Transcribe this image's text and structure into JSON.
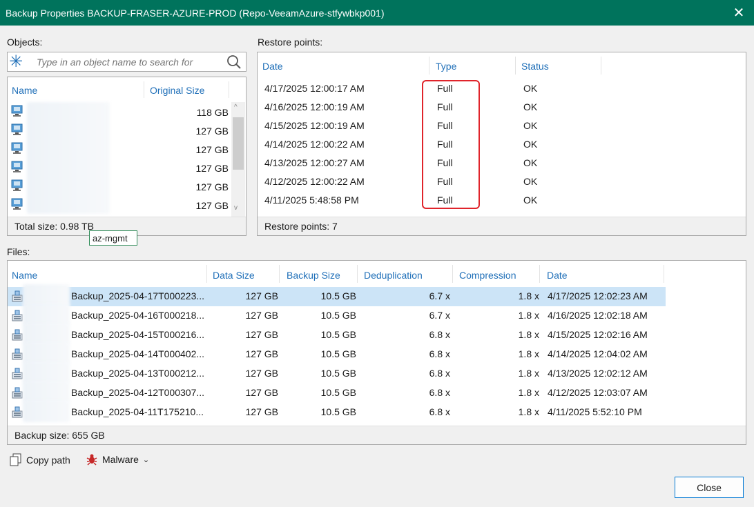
{
  "window": {
    "title": "Backup Properties BACKUP-FRASER-AZURE-PROD (Repo-VeeamAzure-stfywbkp001)",
    "close_icon": "close-icon"
  },
  "objects": {
    "label": "Objects:",
    "search": {
      "placeholder": "Type in an object name to search for",
      "value": ""
    },
    "columns": {
      "name": "Name",
      "size": "Original Size"
    },
    "rows": [
      {
        "name": "",
        "size": "118 GB"
      },
      {
        "name": "",
        "size": "127 GB"
      },
      {
        "name": "",
        "size": "127 GB"
      },
      {
        "name": "",
        "size": "127 GB"
      },
      {
        "name": "",
        "size": "127 GB"
      },
      {
        "name": "",
        "size": "127 GB"
      }
    ],
    "total": "Total size: 0.98 TB",
    "tooltip": "az-mgmt"
  },
  "restore_points": {
    "label": "Restore points:",
    "columns": {
      "date": "Date",
      "type": "Type",
      "status": "Status"
    },
    "rows": [
      {
        "date": "4/17/2025 12:00:17 AM",
        "type": "Full",
        "status": "OK"
      },
      {
        "date": "4/16/2025 12:00:19 AM",
        "type": "Full",
        "status": "OK"
      },
      {
        "date": "4/15/2025 12:00:19 AM",
        "type": "Full",
        "status": "OK"
      },
      {
        "date": "4/14/2025 12:00:22 AM",
        "type": "Full",
        "status": "OK"
      },
      {
        "date": "4/13/2025 12:00:27 AM",
        "type": "Full",
        "status": "OK"
      },
      {
        "date": "4/12/2025 12:00:22 AM",
        "type": "Full",
        "status": "OK"
      },
      {
        "date": "4/11/2025 5:48:58 PM",
        "type": "Full",
        "status": "OK"
      }
    ],
    "footer": "Restore points: 7",
    "highlight_color": "#e0242b"
  },
  "files": {
    "label": "Files:",
    "columns": {
      "name": "Name",
      "data_size": "Data Size",
      "backup_size": "Backup Size",
      "dedup": "Deduplication",
      "compression": "Compression",
      "date": "Date"
    },
    "rows": [
      {
        "name": "Backup_2025-04-17T000223...",
        "data_size": "127 GB",
        "backup_size": "10.5 GB",
        "dedup": "6.7 x",
        "compression": "1.8 x",
        "date": "4/17/2025 12:02:23 AM"
      },
      {
        "name": "Backup_2025-04-16T000218...",
        "data_size": "127 GB",
        "backup_size": "10.5 GB",
        "dedup": "6.7 x",
        "compression": "1.8 x",
        "date": "4/16/2025 12:02:18 AM"
      },
      {
        "name": "Backup_2025-04-15T000216...",
        "data_size": "127 GB",
        "backup_size": "10.5 GB",
        "dedup": "6.8 x",
        "compression": "1.8 x",
        "date": "4/15/2025 12:02:16 AM"
      },
      {
        "name": "Backup_2025-04-14T000402...",
        "data_size": "127 GB",
        "backup_size": "10.5 GB",
        "dedup": "6.8 x",
        "compression": "1.8 x",
        "date": "4/14/2025 12:04:02 AM"
      },
      {
        "name": "Backup_2025-04-13T000212...",
        "data_size": "127 GB",
        "backup_size": "10.5 GB",
        "dedup": "6.8 x",
        "compression": "1.8 x",
        "date": "4/13/2025 12:02:12 AM"
      },
      {
        "name": "Backup_2025-04-12T000307...",
        "data_size": "127 GB",
        "backup_size": "10.5 GB",
        "dedup": "6.8 x",
        "compression": "1.8 x",
        "date": "4/12/2025 12:03:07 AM"
      },
      {
        "name": "Backup_2025-04-11T175210...",
        "data_size": "127 GB",
        "backup_size": "10.5 GB",
        "dedup": "6.8 x",
        "compression": "1.8 x",
        "date": "4/11/2025 5:52:10 PM"
      }
    ],
    "footer": "Backup size: 655 GB",
    "selected_color": "#cce4f7"
  },
  "toolbar": {
    "copy_path": "Copy path",
    "malware": "Malware"
  },
  "buttons": {
    "close": "Close"
  },
  "colors": {
    "titlebar": "#00735c",
    "header_text": "#1f6fb8",
    "accent": "#0078d4"
  }
}
